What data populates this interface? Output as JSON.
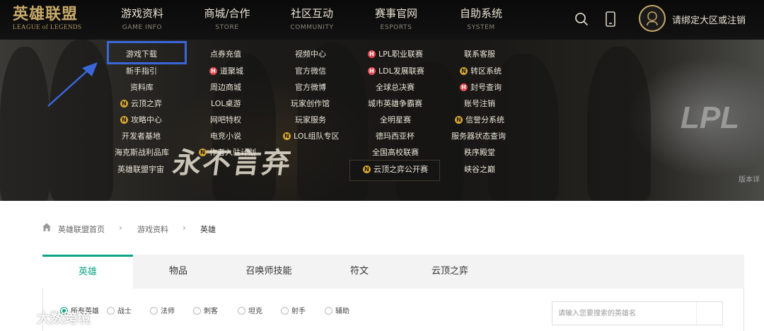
{
  "header": {
    "logo_cn": "英雄联盟",
    "logo_en": "LEAGUE of LEGENDS",
    "nav": [
      {
        "cn": "游戏资料",
        "en": "GAME INFO"
      },
      {
        "cn": "商城/合作",
        "en": "STORE"
      },
      {
        "cn": "社区互动",
        "en": "COMMUNITY"
      },
      {
        "cn": "赛事官网",
        "en": "ESPORTS"
      },
      {
        "cn": "自助系统",
        "en": "SYSTEM"
      }
    ],
    "login_text": "请绑定大区或注销"
  },
  "dropdown": {
    "col1": [
      "游戏下载",
      "新手指引",
      "资料库",
      "云顶之弈",
      "攻略中心",
      "开发者基地",
      "海克斯战利品库",
      "英雄联盟宇宙"
    ],
    "col2": [
      "点券充值",
      "道聚城",
      "周边商城",
      "LOL桌游",
      "网吧特权",
      "电竞小说",
      "作者入驻计划"
    ],
    "col3": [
      "视频中心",
      "官方微信",
      "官方微博",
      "玩家创作馆",
      "玩家服务",
      "LOL组队专区"
    ],
    "col4": [
      "LPL职业联赛",
      "LDL发展联赛",
      "全球总决赛",
      "城市英雄争霸赛",
      "全明星赛",
      "德玛西亚杯",
      "全国高校联赛",
      "云顶之弈公开赛"
    ],
    "col5": [
      "联系客服",
      "转区系统",
      "封号查询",
      "账号注销",
      "信誉分系统",
      "服务器状态查询",
      "秩序殿堂",
      "峡谷之巅"
    ]
  },
  "banner": {
    "slogan": "永不言弃",
    "side_logo": "LPL",
    "version_text": "版本详"
  },
  "breadcrumb": [
    "英雄联盟首页",
    "游戏资料",
    "英雄"
  ],
  "tabs": [
    "英雄",
    "物品",
    "召唤师技能",
    "符文",
    "云顶之弈"
  ],
  "filters": [
    "所有英雄",
    "战士",
    "法师",
    "刺客",
    "坦克",
    "射手",
    "辅助"
  ],
  "search": {
    "placeholder": "请输入您要搜索的英雄名"
  },
  "watermark": "大数跨境",
  "colors": {
    "accent": "#0ea484",
    "gold": "#c8a96a",
    "highlight": "#3a66d8"
  }
}
